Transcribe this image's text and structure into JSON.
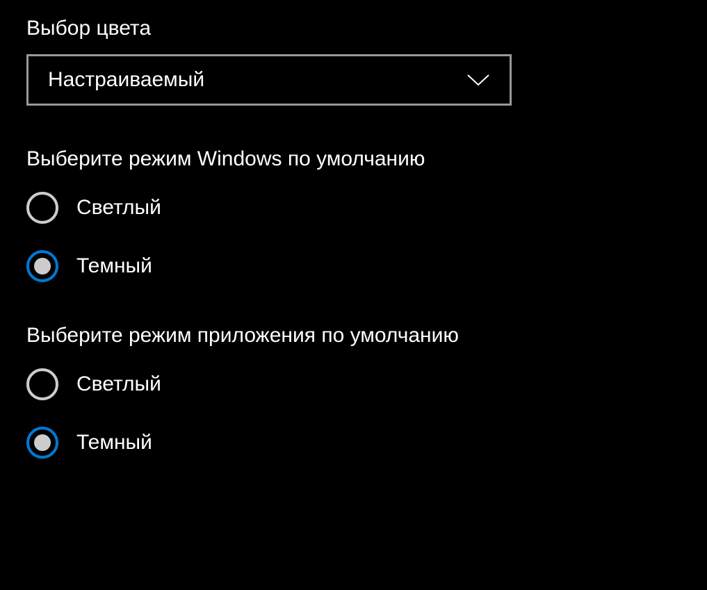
{
  "colorChoice": {
    "label": "Выбор цвета",
    "selected": "Настраиваемый"
  },
  "windowsMode": {
    "label": "Выберите режим Windows по умолчанию",
    "options": {
      "light": "Светлый",
      "dark": "Темный"
    },
    "selected": "dark"
  },
  "appMode": {
    "label": "Выберите режим приложения по умолчанию",
    "options": {
      "light": "Светлый",
      "dark": "Темный"
    },
    "selected": "dark"
  }
}
